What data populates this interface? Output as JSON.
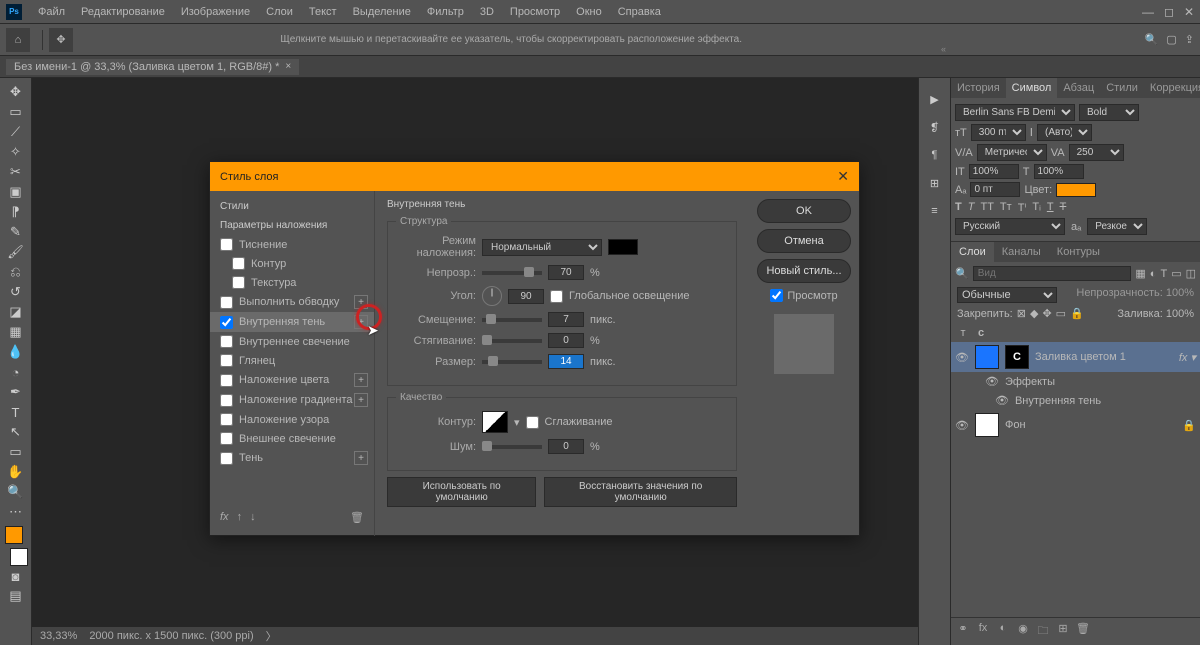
{
  "menu": [
    "Файл",
    "Редактирование",
    "Изображение",
    "Слои",
    "Текст",
    "Выделение",
    "Фильтр",
    "3D",
    "Просмотр",
    "Окно",
    "Справка"
  ],
  "doc_tab": "Без имени-1 @ 33,3% (Заливка цветом 1, RGB/8#) *",
  "hint": "Щелкните мышью и перетаскивайте ее указатель, чтобы скорректировать расположение эффекта.",
  "status": {
    "zoom": "33,33%",
    "info": "2000 пикс. x 1500 пикс. (300 ppi)"
  },
  "panel_tabs_top": [
    "История",
    "Символ",
    "Абзац",
    "Стили",
    "Коррекция"
  ],
  "char": {
    "font": "Berlin Sans FB Demi",
    "weight": "Bold",
    "size": "300 пт",
    "leading": "(Авто)",
    "track": "Метрически",
    "ka": "250",
    "h": "100%",
    "w": "100%",
    "baseline": "0 пт",
    "color_label": "Цвет:",
    "lang": "Русский",
    "aa": "Резкое"
  },
  "layers": {
    "tabs": [
      "Слои",
      "Каналы",
      "Контуры"
    ],
    "search_ph": "Вид",
    "mode": "Обычные",
    "opacity_label": "Непрозрачность:",
    "opacity": "100%",
    "lock_label": "Закрепить:",
    "fill_label": "Заливка:",
    "fill": "100%",
    "items": [
      {
        "name": "Заливка цветом 1"
      },
      {
        "name": "Эффекты"
      },
      {
        "name": "Внутренняя тень"
      },
      {
        "name": "Фон"
      }
    ],
    "c_label": "с",
    "t_label": "т"
  },
  "dialog": {
    "title": "Стиль слоя",
    "styles_hdr": "Стили",
    "params_hdr": "Параметры наложения",
    "styles": [
      "Тиснение",
      "Контур",
      "Текстура",
      "Выполнить обводку",
      "Внутренняя тень",
      "Внутреннее свечение",
      "Глянец",
      "Наложение цвета",
      "Наложение градиента",
      "Наложение узора",
      "Внешнее свечение",
      "Тень"
    ],
    "effect_title": "Внутренняя тень",
    "structure": "Структура",
    "quality": "Качество",
    "blend_mode_label": "Режим наложения:",
    "blend_mode": "Нормальный",
    "opacity_label": "Непрозр.:",
    "opacity": "70",
    "percent": "%",
    "angle_label": "Угол:",
    "angle": "90",
    "global": "Глобальное освещение",
    "distance_label": "Смещение:",
    "distance": "7",
    "px": "пикс.",
    "choke_label": "Стягивание:",
    "choke": "0",
    "size_label": "Размер:",
    "size": "14",
    "contour_label": "Контур:",
    "anti": "Сглаживание",
    "noise_label": "Шум:",
    "noise": "0",
    "defaults": "Использовать по умолчанию",
    "reset": "Восстановить значения по умолчанию",
    "ok": "OK",
    "cancel": "Отмена",
    "new_style": "Новый стиль...",
    "preview": "Просмотр"
  }
}
